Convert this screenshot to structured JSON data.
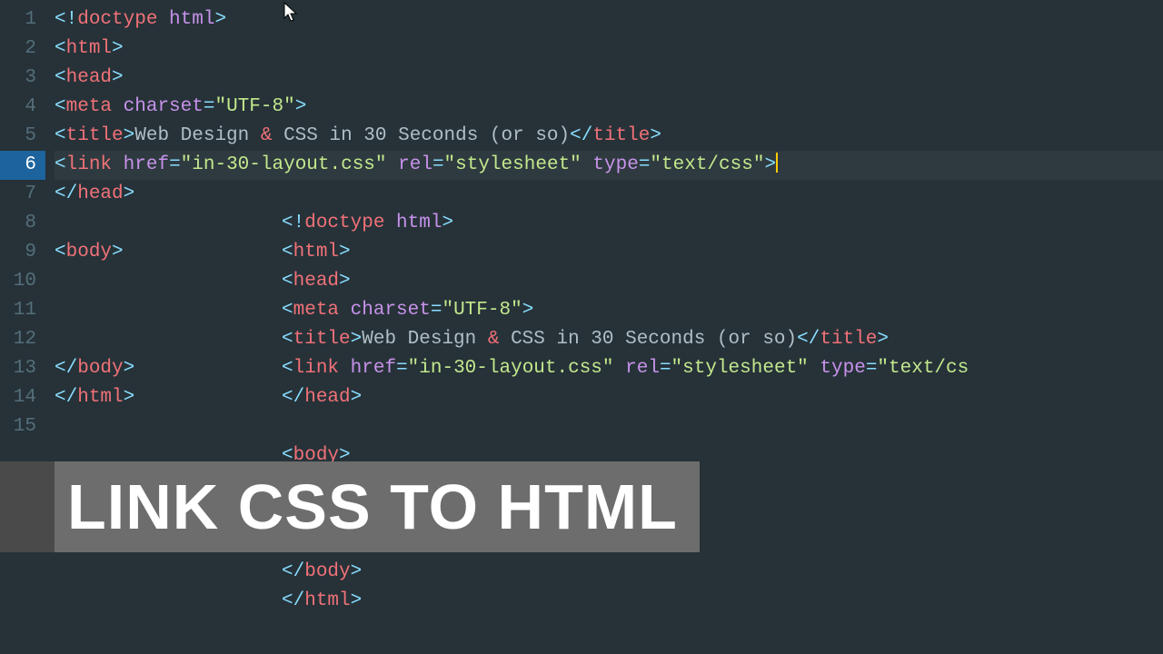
{
  "banner_text": "LINK CSS TO HTML",
  "active_line": 6,
  "gutter": [
    "1",
    "2",
    "3",
    "4",
    "5",
    "6",
    "7",
    "8",
    "9",
    "10",
    "11",
    "12",
    "13",
    "14",
    "15"
  ],
  "tokens": {
    "doctype_open": "<!",
    "doctype_word": "doctype",
    "html_word": "html",
    "gt": ">",
    "lt": "<",
    "lts": "</",
    "head": "head",
    "meta": "meta",
    "charset_attr": "charset",
    "eq": "=",
    "utf8": "\"UTF-8\"",
    "title": "title",
    "title_text": "Web Design ",
    "amp": "&",
    "title_text2": " CSS in 30 Seconds (or so)",
    "link": "link",
    "href_attr": "href",
    "href_val": "\"in-30-layout.css\"",
    "rel_attr": "rel",
    "rel_val": "\"stylesheet\"",
    "type_attr": "type",
    "type_val": "\"text/css\"",
    "type_val_cut": "\"text/cs",
    "body": "body"
  }
}
